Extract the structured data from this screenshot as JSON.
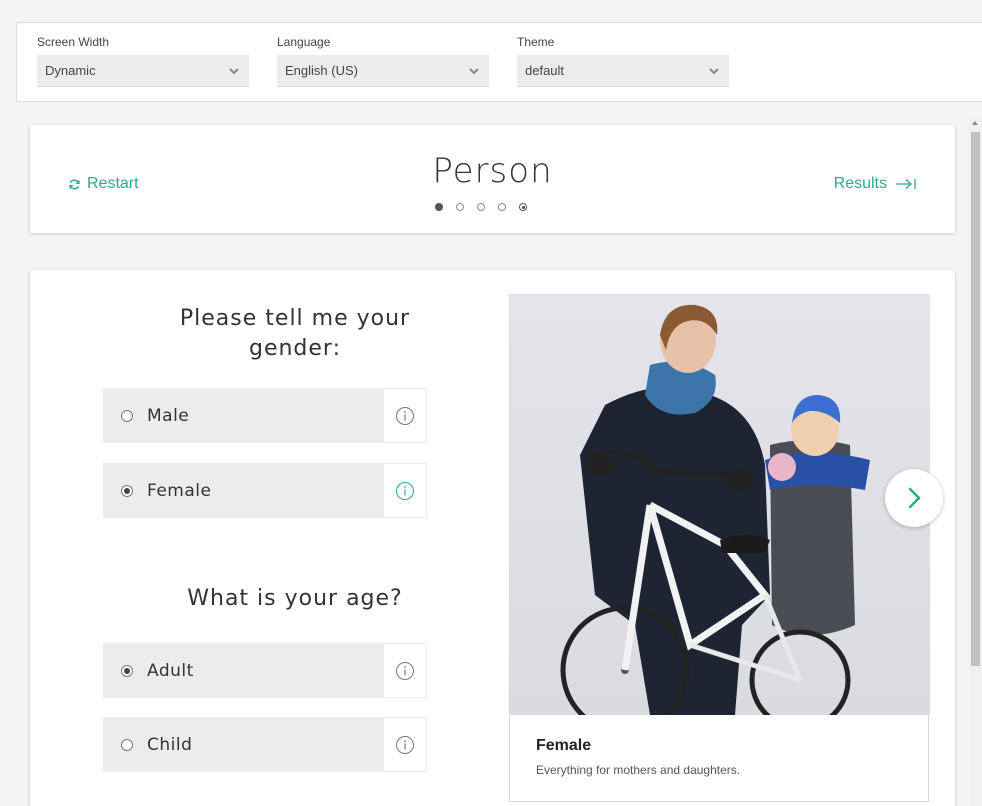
{
  "settings": {
    "screen_width": {
      "label": "Screen Width",
      "value": "Dynamic"
    },
    "language": {
      "label": "Language",
      "value": "English (US)"
    },
    "theme": {
      "label": "Theme",
      "value": "default"
    }
  },
  "header": {
    "restart_label": "Restart",
    "title": "Person",
    "results_label": "Results",
    "progress": {
      "total_steps": 5,
      "current_step": 1
    }
  },
  "questions": [
    {
      "text": "Please tell me your gender:",
      "options": [
        {
          "label": "Male",
          "selected": false
        },
        {
          "label": "Female",
          "selected": true
        }
      ]
    },
    {
      "text": "What is your age?",
      "options": [
        {
          "label": "Adult",
          "selected": true
        },
        {
          "label": "Child",
          "selected": false
        }
      ]
    }
  ],
  "preview": {
    "title": "Female",
    "subtitle": "Everything for mothers and daughters."
  },
  "colors": {
    "accent": "#2fa88e",
    "option_bg": "#ececec"
  },
  "icons": {
    "restart": "refresh-icon",
    "results": "arrow-to-end-icon",
    "info": "info-icon",
    "next": "chevron-right-icon",
    "select": "chevron-down-icon"
  }
}
